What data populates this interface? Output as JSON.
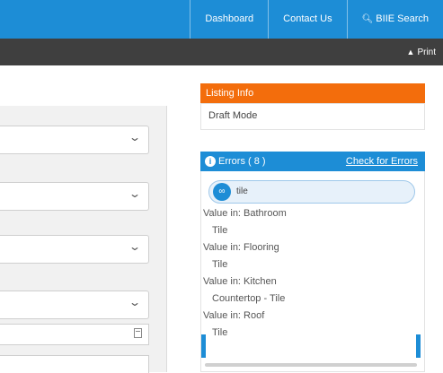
{
  "topnav": {
    "items": [
      {
        "label": "Dashboard"
      },
      {
        "label": "Contact Us"
      },
      {
        "label": "BIIE Search",
        "icon": "search-icon"
      }
    ]
  },
  "toolbar": {
    "print_label": "Print",
    "print_icon": "print-icon"
  },
  "left": {
    "selects": [
      {
        "value": ""
      },
      {
        "value": ""
      },
      {
        "value": ""
      },
      {
        "value": ""
      }
    ],
    "date_input": {
      "value": ""
    }
  },
  "listing_info": {
    "title": "Listing Info",
    "status": "Draft Mode"
  },
  "errors": {
    "title": "Errors ( 8 )",
    "check_link": "Check for Errors",
    "pill": {
      "badge": "",
      "text": "tile"
    },
    "rows": [
      "Value in: Bathroom",
      "Tile",
      "Value in: Flooring",
      "Tile",
      "Value in: Kitchen",
      "Countertop - Tile",
      "Value in: Roof",
      "Tile"
    ]
  },
  "colors": {
    "primary_blue": "#1d8dd6",
    "accent_orange": "#f36d0c",
    "dark_bar": "#3f3f3f"
  }
}
